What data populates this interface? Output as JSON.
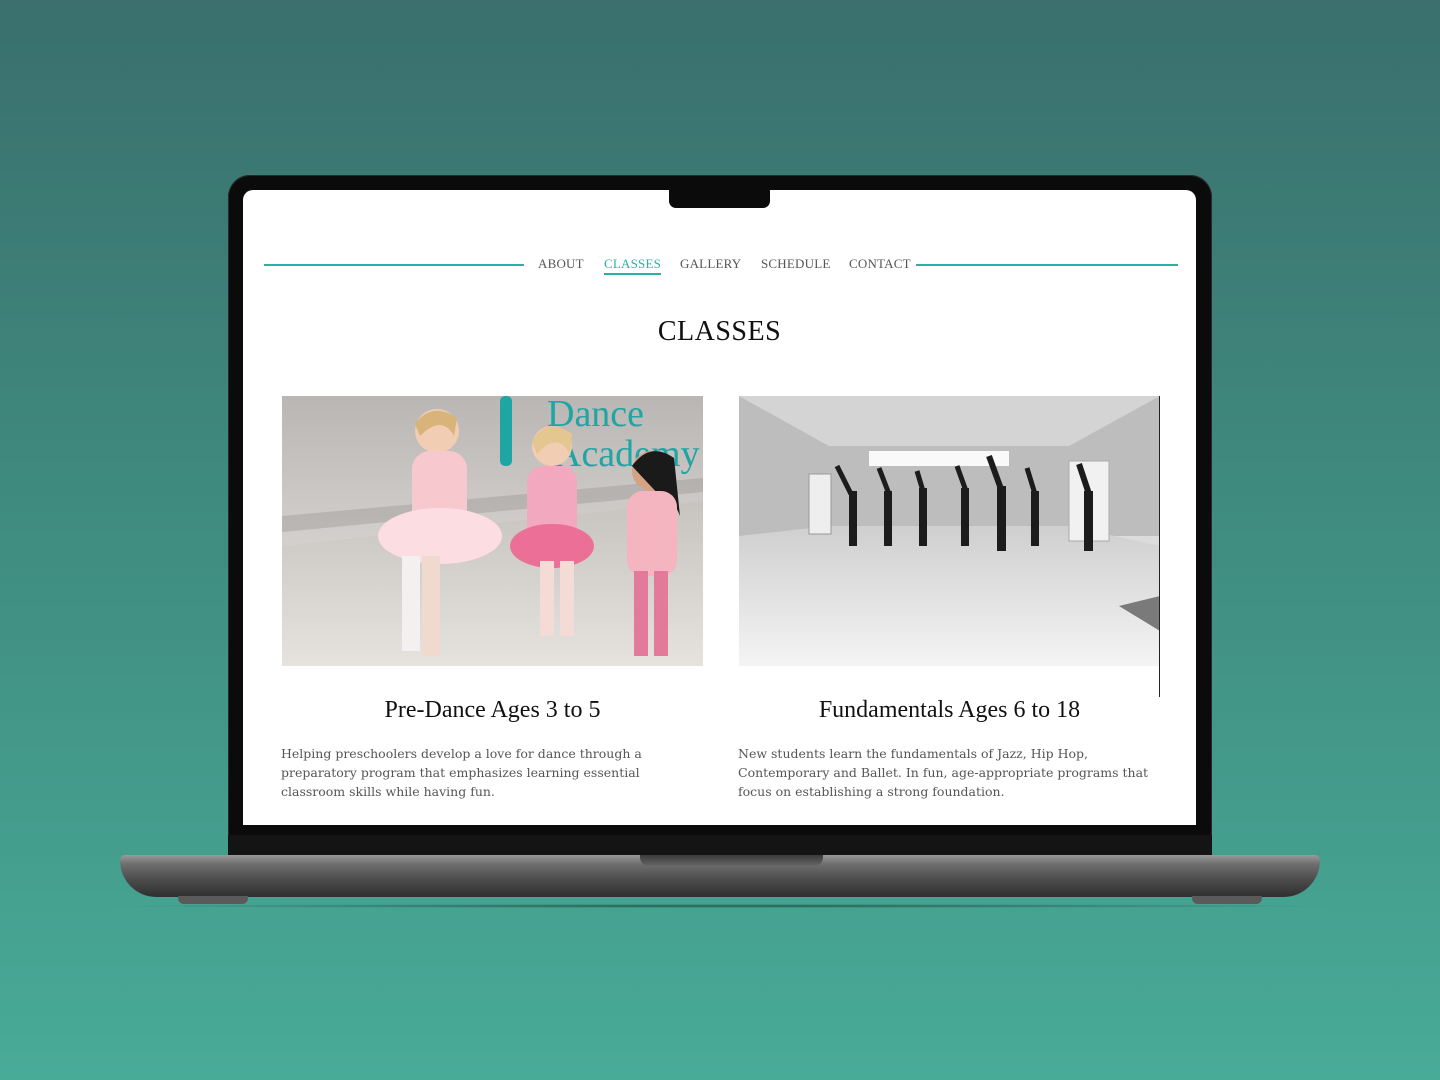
{
  "nav": {
    "items": [
      {
        "label": "ABOUT",
        "active": false
      },
      {
        "label": "CLASSES",
        "active": true
      },
      {
        "label": "GALLERY",
        "active": false
      },
      {
        "label": "SCHEDULE",
        "active": false
      },
      {
        "label": "CONTACT",
        "active": false
      }
    ]
  },
  "page": {
    "title": "CLASSES"
  },
  "classes": [
    {
      "title": "Pre-Dance Ages 3 to 5",
      "description": "Helping preschoolers develop a love for dance through a preparatory program that emphasizes learning essential classroom skills while having fun.",
      "photo_sign_text": "Dance Academy"
    },
    {
      "title": "Fundamentals Ages 6 to 18",
      "description": "New students learn the fundamentals of Jazz, Hip Hop, Contemporary and Ballet. In fun, age-appropriate programs that focus on establishing a strong foundation."
    }
  ],
  "colors": {
    "accent": "#2bb1a3",
    "background_top": "#3a6f6d",
    "background_bottom": "#48ab98"
  }
}
